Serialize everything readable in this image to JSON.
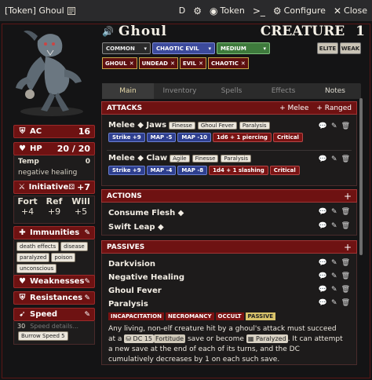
{
  "titlebar": {
    "title": "[Token] Ghoul",
    "d_label": "D",
    "token_label": "Token",
    "configure_label": "Configure",
    "close_label": "Close"
  },
  "header": {
    "name": "Ghoul",
    "type": "CREATURE",
    "level": "1",
    "rarity": "COMMON",
    "alignment": "CHAOTIC EVIL",
    "size": "MEDIUM",
    "elite_label": "ELITE",
    "weak_label": "WEAK",
    "traits": [
      "GHOUL",
      "UNDEAD",
      "EVIL",
      "CHAOTIC"
    ]
  },
  "tabs": [
    "Main",
    "Inventory",
    "Spells",
    "Effects",
    "Notes"
  ],
  "stats": {
    "ac_label": "AC",
    "ac_value": "16",
    "hp_label": "HP",
    "hp_value": "20 / 20",
    "temp_label": "Temp",
    "temp_value": "0",
    "hp_note": "negative healing",
    "initiative_label": "Initiative",
    "initiative_value": "+7",
    "fort_label": "Fort",
    "fort_value": "+4",
    "ref_label": "Ref",
    "ref_value": "+9",
    "will_label": "Will",
    "will_value": "+5",
    "immunities_label": "Immunities",
    "immunities": [
      "death effects",
      "disease",
      "paralyzed",
      "poison",
      "unconscious"
    ],
    "weaknesses_label": "Weaknesses",
    "resistances_label": "Resistances",
    "speed_label": "Speed",
    "speed_value": "30",
    "speed_placeholder": "Speed details...",
    "burrow": "Burrow Speed 5"
  },
  "attacks": {
    "header": "ATTACKS",
    "add_melee": "+ Melee",
    "add_ranged": "+ Ranged",
    "items": [
      {
        "name": "Melee ◆ Jaws",
        "tags": [
          "Finesse",
          "Ghoul Fever",
          "Paralysis"
        ],
        "strikes": [
          "Strike +9",
          "MAP -5",
          "MAP -10"
        ],
        "damage": [
          "1d6 + 1 piercing",
          "Critical"
        ]
      },
      {
        "name": "Melee ◆ Claw",
        "tags": [
          "Agile",
          "Finesse",
          "Paralysis"
        ],
        "strikes": [
          "Strike +9",
          "MAP -4",
          "MAP -8"
        ],
        "damage": [
          "1d4 + 1 slashing",
          "Critical"
        ]
      }
    ]
  },
  "actions": {
    "header": "ACTIONS",
    "add": "+",
    "items": [
      "Consume Flesh ◆",
      "Swift Leap ◆"
    ]
  },
  "passives": {
    "header": "PASSIVES",
    "add": "+",
    "items": [
      "Darkvision",
      "Negative Healing",
      "Ghoul Fever",
      "Paralysis"
    ],
    "paralysis_tags": [
      "INCAPACITATION",
      "NECROMANCY",
      "OCCULT",
      "PASSIVE"
    ],
    "desc_1": "Any living, non-elf creature hit by a ghoul's attack must succeed at a",
    "chip_dc": "DC 15",
    "chip_save": "Fortitude",
    "desc_2": "save or become",
    "chip_cond": "Paralyzed",
    "desc_3": ". It can attempt a new save at the end of each of its turns, and the DC cumulatively decreases by 1 on each such save."
  }
}
